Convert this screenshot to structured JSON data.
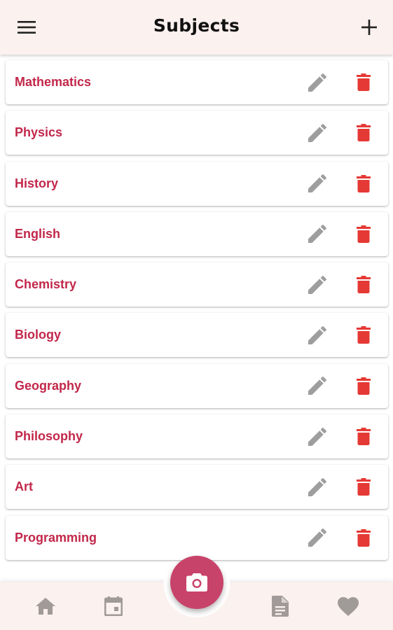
{
  "header": {
    "title": "Subjects",
    "menu_icon": "menu-icon",
    "add_icon": "plus-icon"
  },
  "subjects": [
    {
      "name": "Mathematics"
    },
    {
      "name": "Physics"
    },
    {
      "name": "History"
    },
    {
      "name": "English"
    },
    {
      "name": "Chemistry"
    },
    {
      "name": "Biology"
    },
    {
      "name": "Geography"
    },
    {
      "name": "Philosophy"
    },
    {
      "name": "Art"
    },
    {
      "name": "Programming"
    }
  ],
  "row_icons": {
    "edit": "pencil-icon",
    "delete": "trash-icon"
  },
  "bottom_nav": {
    "items": [
      "home-icon",
      "calendar-icon",
      "document-icon",
      "heart-icon"
    ],
    "fab_icon": "camera-icon"
  },
  "colors": {
    "accent": "#c2274a",
    "delete": "#e53935",
    "fab": "#c8436a",
    "bar_background": "#fbf1ee",
    "icon_gray": "#9e9e9e"
  }
}
